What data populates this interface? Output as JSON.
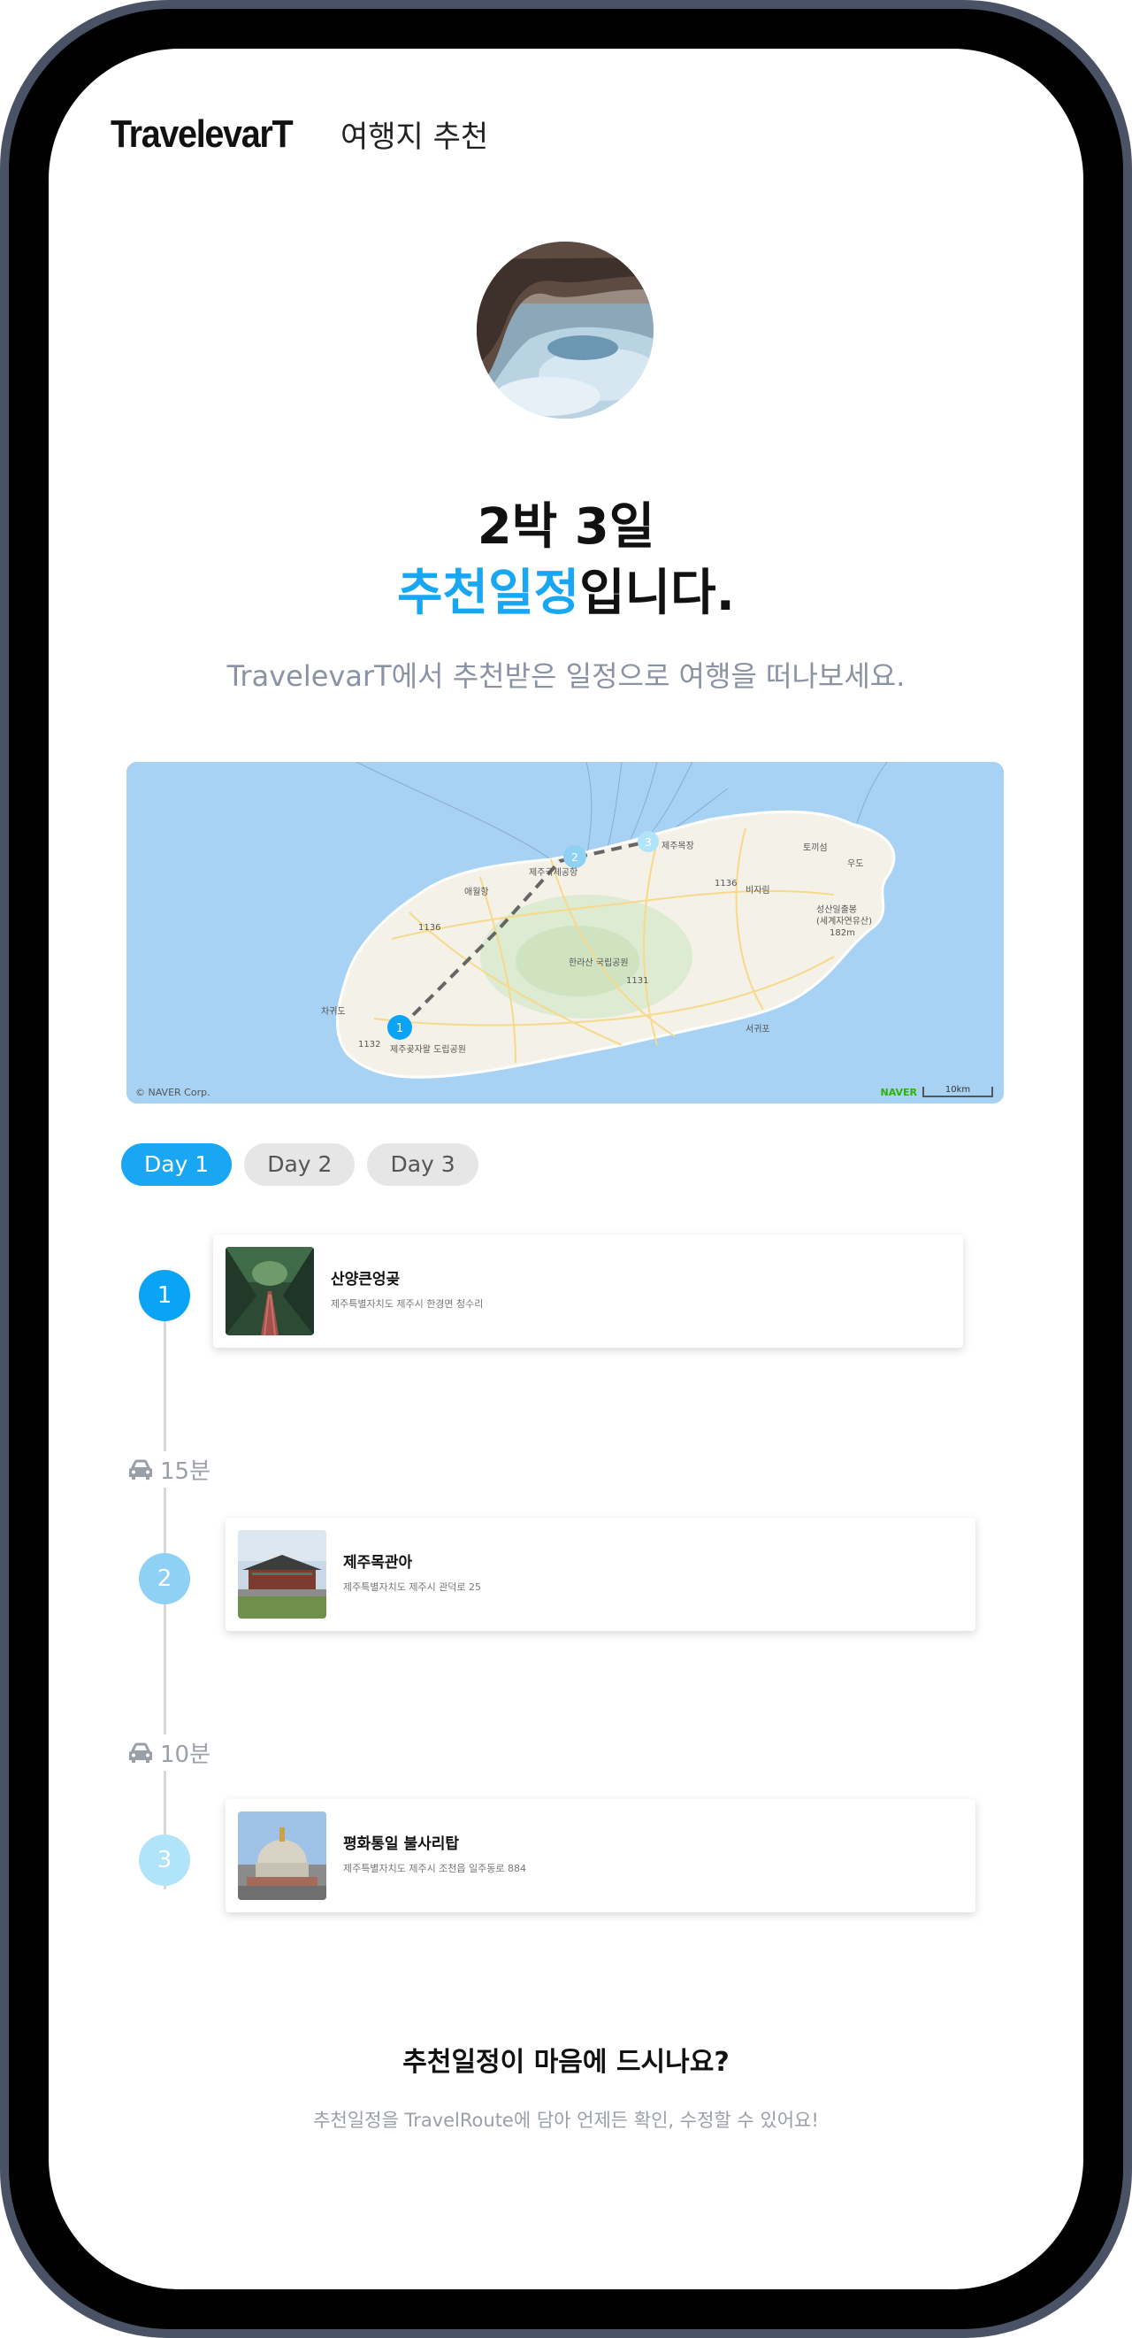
{
  "header": {
    "logo": "TravelevarT",
    "subtitle": "여행지 추천"
  },
  "hero": {
    "title_line1": "2박 3일",
    "title_highlight": "추천일정",
    "title_suffix": "입니다.",
    "description": "TravelevarT에서 추천받은 일정으로 여행을 떠나보세요."
  },
  "map": {
    "copyright": "© NAVER Corp.",
    "brand": "NAVER",
    "scale": "10km",
    "labels": {
      "airport": "제주국제공항",
      "port": "애월항",
      "mountain": "한라산 국립공원",
      "seongsan": "성산일출봉",
      "seongsan_desc": "(세계자연유산)",
      "seongsan_alt": "182m",
      "udo": "우도",
      "tokki": "토끼섬",
      "bijarim": "비자림",
      "jeju_port": "제주목장",
      "seogwipo": "서귀포",
      "park": "제주곶자왈 도립공원",
      "chagwido": "차귀도",
      "road_1136a": "1136",
      "road_1136b": "1136",
      "road_1131": "1131",
      "road_1132": "1132"
    },
    "markers": [
      "1",
      "2",
      "3"
    ]
  },
  "tabs": [
    {
      "label": "Day 1",
      "active": true
    },
    {
      "label": "Day 2",
      "active": false
    },
    {
      "label": "Day 3",
      "active": false
    }
  ],
  "steps": [
    {
      "number": "1",
      "name": "산양큰엉곶",
      "address": "제주특별자치도 제주시 한경면 청수리",
      "color": "#0aa3f5"
    },
    {
      "number": "2",
      "name": "제주목관아",
      "address": "제주특별자치도 제주시 관덕로 25",
      "color": "#8fd0f5"
    },
    {
      "number": "3",
      "name": "평화통일 불사리탑",
      "address": "제주특별자치도 제주시 조천읍 일주동로 884",
      "color": "#b2e4f9"
    }
  ],
  "durations": [
    "15분",
    "10분"
  ],
  "footer": {
    "title": "추천일정이 마음에 드시나요?",
    "description": "추천일정을 TravelRoute에 담아 언제든 확인, 수정할 수 있어요!"
  },
  "colors": {
    "accent": "#19a6f2",
    "phone_frame": "#4a5366"
  }
}
